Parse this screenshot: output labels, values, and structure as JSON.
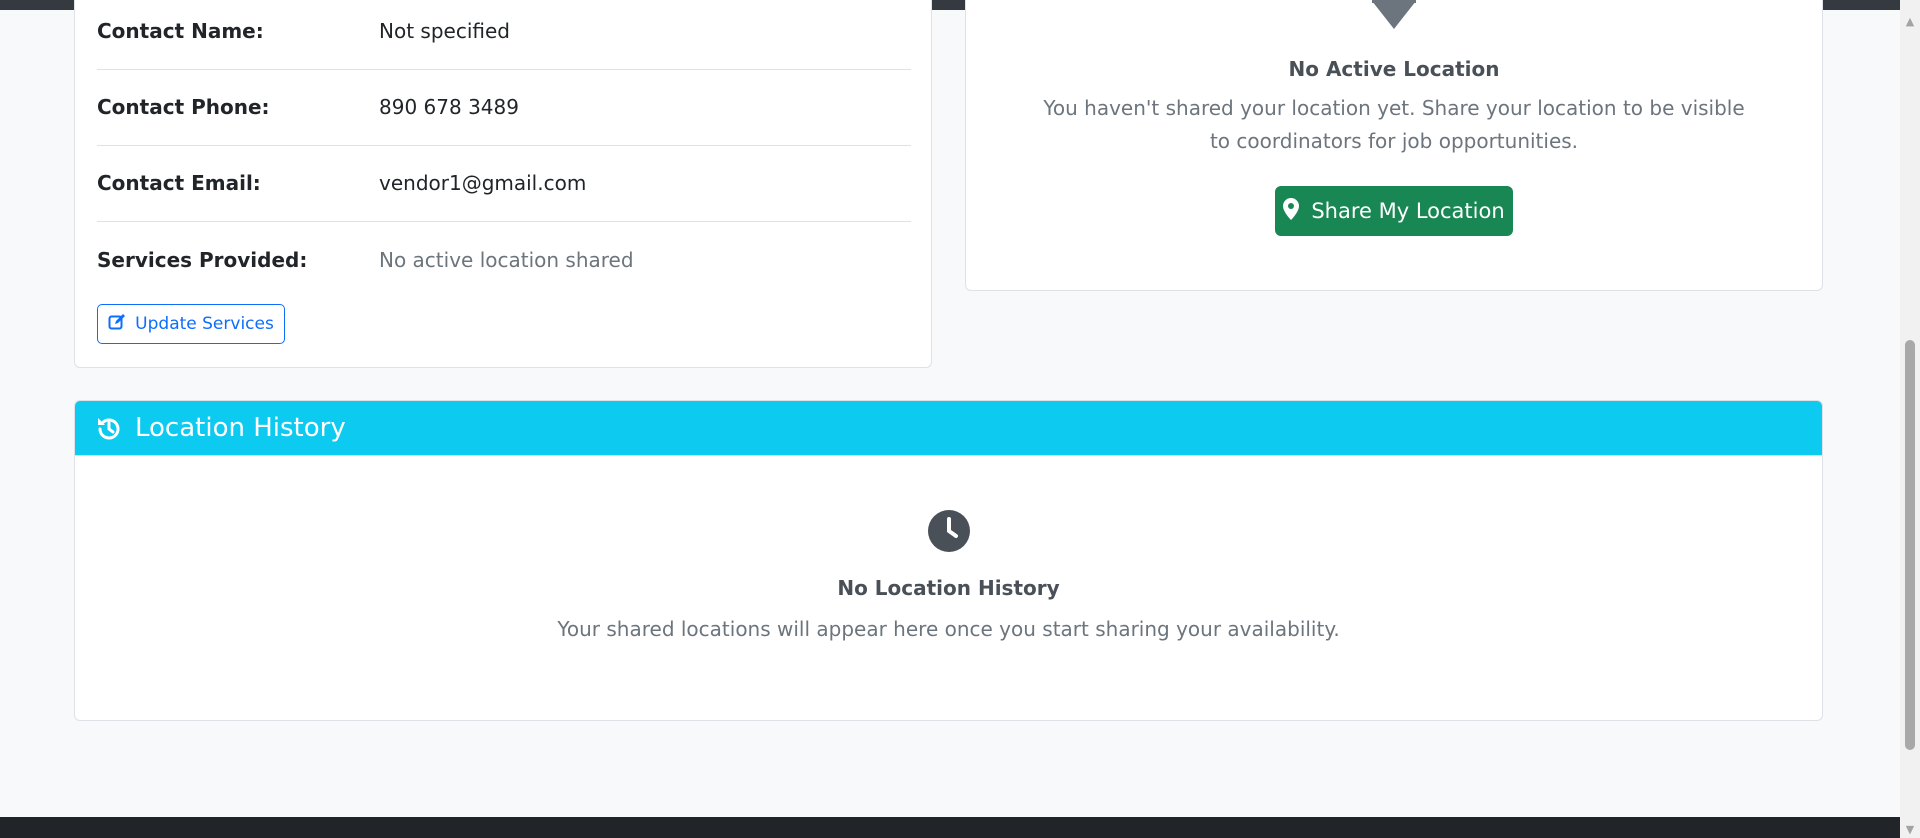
{
  "vendor_details": {
    "rows": [
      {
        "label": "Contact Name:",
        "value": "Not specified"
      },
      {
        "label": "Contact Phone:",
        "value": "890 678 3489"
      },
      {
        "label": "Contact Email:",
        "value": "vendor1@gmail.com"
      },
      {
        "label": "Services Provided:",
        "value": "No active location shared"
      }
    ],
    "update_button_label": "Update Services"
  },
  "location_status": {
    "title": "No Active Location",
    "message": "You haven't shared your location yet. Share your location to be visible to coordinators for job opportunities.",
    "share_button_label": "Share My Location"
  },
  "location_history": {
    "header": "Location History",
    "empty_title": "No Location History",
    "empty_message": "Your shared locations will appear here once you start sharing your availability."
  },
  "colors": {
    "info_header": "#0dcaf0",
    "success_button": "#198754",
    "primary_outline": "#0d6efd"
  },
  "icons": {
    "update_button": "edit-icon",
    "share_button": "map-pin-icon",
    "history_header": "history-icon",
    "empty_history": "clock-icon"
  }
}
